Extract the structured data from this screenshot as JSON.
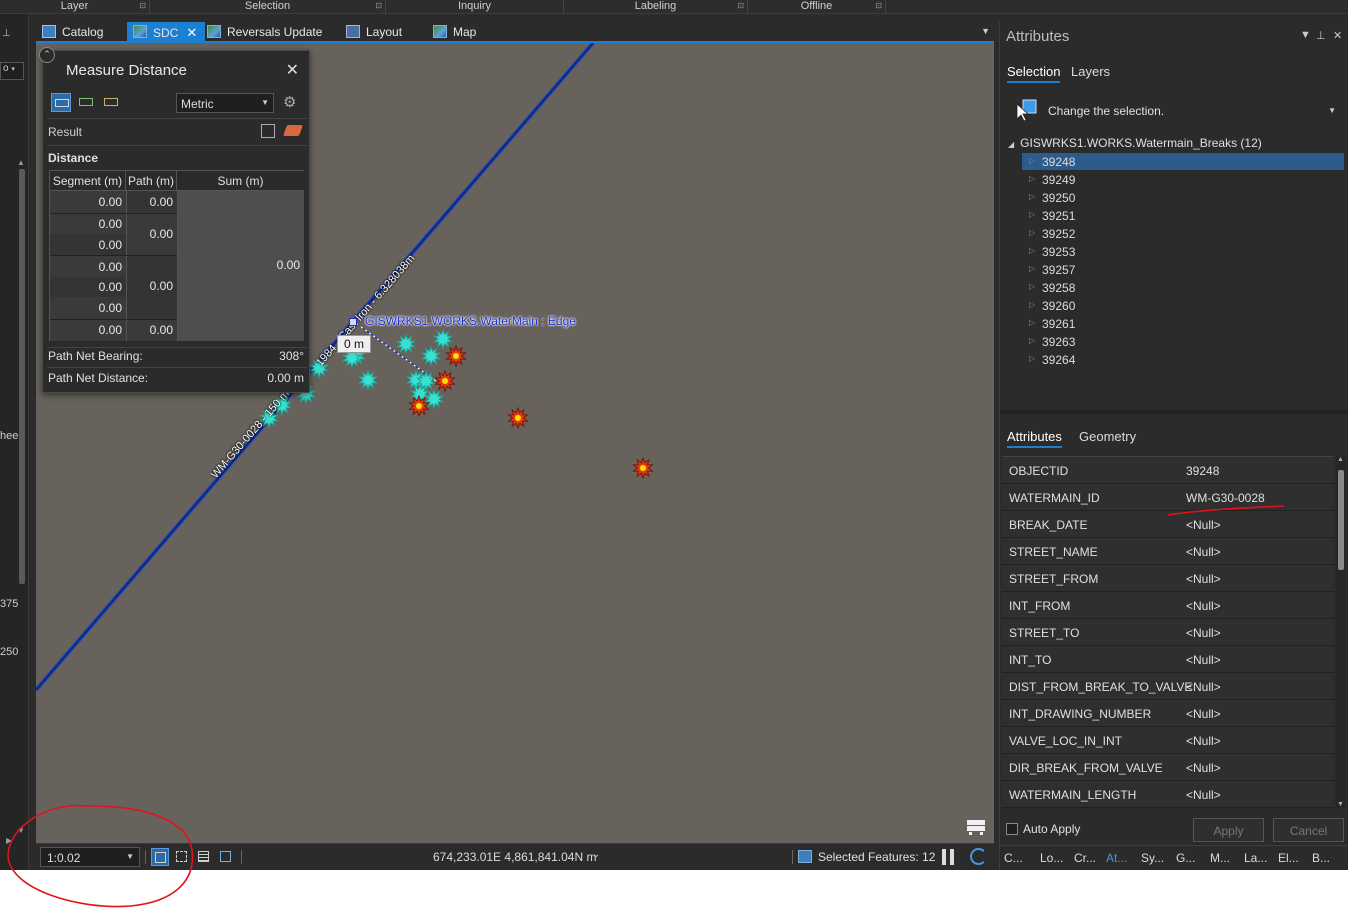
{
  "ribbon": {
    "groups": [
      {
        "label": "Layer"
      },
      {
        "label": "Selection"
      },
      {
        "label": "Inquiry"
      },
      {
        "label": "Labeling"
      },
      {
        "label": "Offline"
      }
    ]
  },
  "left_strip": {
    "combo_value": "o",
    "fragments": [
      "hee",
      "375",
      "250"
    ]
  },
  "tabs": [
    {
      "label": "Catalog"
    },
    {
      "label": "SDC",
      "active": true
    },
    {
      "label": "Reversals Update"
    },
    {
      "label": "Layout"
    },
    {
      "label": "Map"
    }
  ],
  "map": {
    "labels": {
      "wm_main": "WM-G30-0028 - 150 mm",
      "wm_cast": "1984 - Cast Iron - 6.328038m",
      "edge_snap": "GISWRKS1.WORKS.WaterMain : Edge",
      "measure_tip": "0 m"
    },
    "colors": {
      "background": "#68625d",
      "water_main": "#1a3fb8",
      "selected_break": "#39e0d0",
      "break_symbol": "#e53a12"
    }
  },
  "measure": {
    "title": "Measure Distance",
    "unit": "Metric",
    "result_label": "Result",
    "distance_label": "Distance",
    "headers": {
      "segment": "Segment (m)",
      "path": "Path (m)",
      "sum": "Sum (m)"
    },
    "segments": [
      "0.00",
      "0.00",
      "0.00",
      "0.00",
      "0.00",
      "0.00",
      "0.00"
    ],
    "paths": [
      "0.00",
      "0.00",
      "0.00",
      "0.00"
    ],
    "sum": "0.00",
    "bearing_label": "Path Net Bearing:",
    "bearing_value": "308°",
    "netdist_label": "Path Net Distance:",
    "netdist_value": "0.00 m"
  },
  "status": {
    "scale": "1:0.02",
    "coords": "674,233.01E 4,861,841.04N m",
    "selected_features": "Selected Features: 12"
  },
  "attributes": {
    "title": "Attributes",
    "top_tabs": {
      "selection": "Selection",
      "layers": "Layers"
    },
    "change_selection": "Change the selection.",
    "layer": "GISWRKS1.WORKS.Watermain_Breaks (12)",
    "ids": [
      "39248",
      "39249",
      "39250",
      "39251",
      "39252",
      "39253",
      "39257",
      "39258",
      "39260",
      "39261",
      "39263",
      "39264"
    ],
    "bottom_tabs": {
      "attributes": "Attributes",
      "geometry": "Geometry"
    },
    "fields": [
      {
        "name": "OBJECTID",
        "value": "39248"
      },
      {
        "name": "WATERMAIN_ID",
        "value": "WM-G30-0028"
      },
      {
        "name": "BREAK_DATE",
        "value": "<Null>"
      },
      {
        "name": "STREET_NAME",
        "value": "<Null>"
      },
      {
        "name": "STREET_FROM",
        "value": "<Null>"
      },
      {
        "name": "INT_FROM",
        "value": "<Null>"
      },
      {
        "name": "STREET_TO",
        "value": "<Null>"
      },
      {
        "name": "INT_TO",
        "value": "<Null>"
      },
      {
        "name": "DIST_FROM_BREAK_TO_VALVE",
        "value": "<Null>"
      },
      {
        "name": "INT_DRAWING_NUMBER",
        "value": "<Null>"
      },
      {
        "name": "VALVE_LOC_IN_INT",
        "value": "<Null>"
      },
      {
        "name": "DIR_BREAK_FROM_VALVE",
        "value": "<Null>"
      },
      {
        "name": "WATERMAIN_LENGTH",
        "value": "<Null>"
      }
    ],
    "auto_apply": "Auto Apply",
    "apply": "Apply",
    "cancel": "Cancel",
    "dock_tabs": [
      "C...",
      "Lo...",
      "Cr...",
      "At...",
      "Sy...",
      "G...",
      "M...",
      "La...",
      "El...",
      "B..."
    ]
  }
}
